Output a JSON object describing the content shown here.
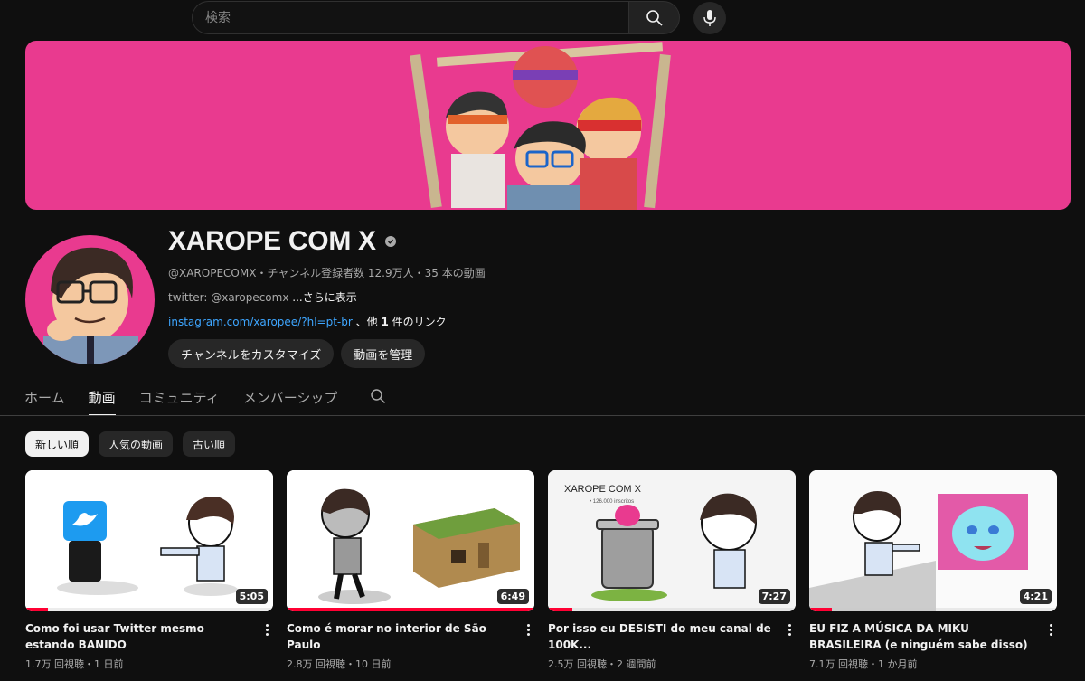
{
  "search": {
    "placeholder": "検索"
  },
  "channel": {
    "name": "XAROPE COM X",
    "handle": "@XAROPECOMX",
    "subscribers": "チャンネル登録者数 12.9万人",
    "video_count": "35 本の動画",
    "separator": "・",
    "description": "twitter: @xaropecomx",
    "more": "...さらに表示",
    "link": "instagram.com/xaropee/?hl=pt-br",
    "link_suffix_1": " 、他 ",
    "link_suffix_bold": "1",
    "link_suffix_2": " 件のリンク",
    "buttons": [
      "チャンネルをカスタマイズ",
      "動画を管理"
    ]
  },
  "tabs": [
    {
      "label": "ホーム",
      "active": false
    },
    {
      "label": "動画",
      "active": true
    },
    {
      "label": "コミュニティ",
      "active": false
    },
    {
      "label": "メンバーシップ",
      "active": false
    }
  ],
  "sort_chips": [
    {
      "label": "新しい順",
      "active": true
    },
    {
      "label": "人気の動画",
      "active": false
    },
    {
      "label": "古い順",
      "active": false
    }
  ],
  "videos": [
    {
      "title": "Como foi usar Twitter mesmo estando BANIDO",
      "views": "1.7万 回視聴",
      "age": "1 日前",
      "duration": "5:05",
      "watched": 0.09
    },
    {
      "title": "Como é morar no interior de São Paulo",
      "views": "2.8万 回視聴",
      "age": "10 日前",
      "duration": "6:49",
      "watched": 1.0
    },
    {
      "title": "Por isso eu DESISTI do meu canal de 100K...",
      "views": "2.5万 回視聴",
      "age": "2 週間前",
      "duration": "7:27",
      "watched": 0.1
    },
    {
      "title": "EU FIZ A MÚSICA DA MIKU BRASILEIRA (e ninguém sabe disso)",
      "views": "7.1万 回視聴",
      "age": "1 か月前",
      "duration": "4:21",
      "watched": 0.09
    }
  ],
  "thumb3_overlay": {
    "name": "XAROPE COM X",
    "subs": "• 126.000 inscritos"
  },
  "meta_dot": "・",
  "colors": {
    "banner": "#e93a8f",
    "link": "#3ea6ff",
    "progress": "#ff0033"
  }
}
